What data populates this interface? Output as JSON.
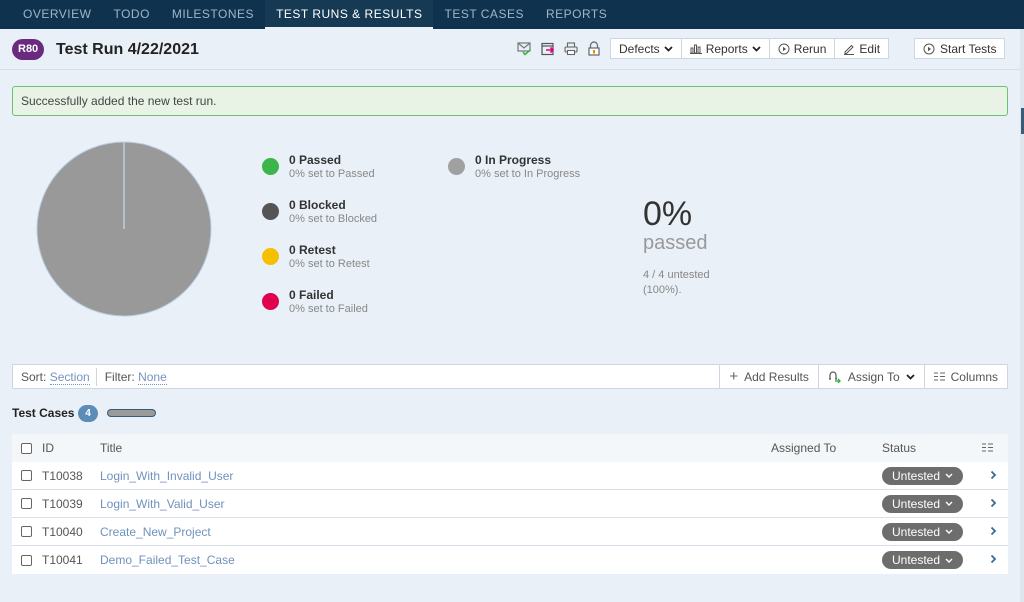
{
  "nav": {
    "tabs": [
      {
        "label": "OVERVIEW",
        "active": false
      },
      {
        "label": "TODO",
        "active": false
      },
      {
        "label": "MILESTONES",
        "active": false
      },
      {
        "label": "TEST RUNS & RESULTS",
        "active": true
      },
      {
        "label": "TEST CASES",
        "active": false
      },
      {
        "label": "REPORTS",
        "active": false
      }
    ]
  },
  "header": {
    "run_badge": "R80",
    "title": "Test Run 4/22/2021",
    "icons": [
      "email-check-icon",
      "export-icon",
      "print-icon",
      "lock-icon"
    ],
    "buttons": {
      "defects": "Defects",
      "reports": "Reports",
      "rerun": "Rerun",
      "edit": "Edit",
      "start_tests": "Start Tests"
    }
  },
  "alert": {
    "message": "Successfully added the new test run."
  },
  "chart_data": {
    "type": "pie",
    "title": "",
    "slices": [
      {
        "label": "Passed",
        "value": 0,
        "color": "#3cb54a"
      },
      {
        "label": "Blocked",
        "value": 0,
        "color": "#555555"
      },
      {
        "label": "Retest",
        "value": 0,
        "color": "#f5c000"
      },
      {
        "label": "Failed",
        "value": 0,
        "color": "#e0004d"
      },
      {
        "label": "In Progress",
        "value": 0,
        "color": "#9a9a9a"
      },
      {
        "label": "Untested",
        "value": 4,
        "color": "#999999"
      }
    ]
  },
  "legend": [
    {
      "count": "0 Passed",
      "sub": "0% set to Passed",
      "color": "#3cb54a"
    },
    {
      "count": "0 Blocked",
      "sub": "0% set to Blocked",
      "color": "#555555"
    },
    {
      "count": "0 Retest",
      "sub": "0% set to Retest",
      "color": "#f5c000"
    },
    {
      "count": "0 Failed",
      "sub": "0% set to Failed",
      "color": "#e0004d"
    },
    {
      "count": "0 In Progress",
      "sub": "0% set to In Progress",
      "color": "#a0a0a0"
    }
  ],
  "summary": {
    "percent": "0%",
    "label": "passed",
    "note": "4 / 4 untested (100%)."
  },
  "toolbar": {
    "sort_label": "Sort:",
    "sort_value": "Section",
    "filter_label": "Filter:",
    "filter_value": "None",
    "add_results": "Add Results",
    "assign_to": "Assign To",
    "columns": "Columns"
  },
  "section": {
    "title": "Test Cases",
    "count": "4"
  },
  "table": {
    "headers": {
      "id": "ID",
      "title": "Title",
      "assigned": "Assigned To",
      "status": "Status"
    },
    "rows": [
      {
        "id": "T10038",
        "title": "Login_With_Invalid_User",
        "assigned": "",
        "status": "Untested"
      },
      {
        "id": "T10039",
        "title": "Login_With_Valid_User",
        "assigned": "",
        "status": "Untested"
      },
      {
        "id": "T10040",
        "title": "Create_New_Project",
        "assigned": "",
        "status": "Untested"
      },
      {
        "id": "T10041",
        "title": "Demo_Failed_Test_Case",
        "assigned": "",
        "status": "Untested"
      }
    ]
  }
}
